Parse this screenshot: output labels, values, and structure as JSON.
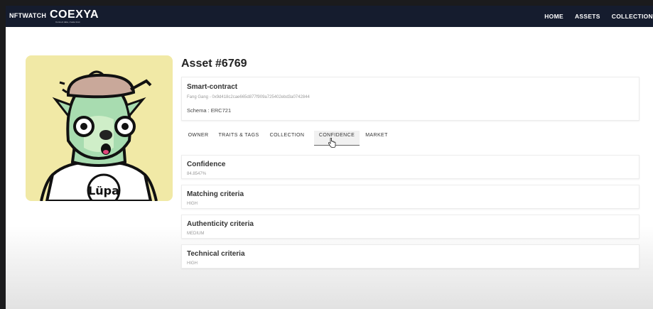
{
  "header": {
    "brand": "NFTWATCH",
    "logo_text": "COEXYA",
    "logo_tagline": "Connect data, create trust",
    "nav": [
      "HOME",
      "ASSETS",
      "COLLECTION"
    ]
  },
  "asset": {
    "title": "Asset #6769",
    "smart_contract": {
      "heading": "Smart-contract",
      "address": "Fang Gang - 0x9d418c2cae665d877f909a725402ebd3a0742844",
      "schema": "Schema : ERC721"
    },
    "tabs": [
      "OWNER",
      "TRAITS & TAGS",
      "COLLECTION",
      "CONFIDENCE",
      "MARKET"
    ],
    "active_tab": "CONFIDENCE",
    "criteria": [
      {
        "label": "Confidence",
        "value": "84.8547%"
      },
      {
        "label": "Matching criteria",
        "value": "HIGH"
      },
      {
        "label": "Authenticity criteria",
        "value": "MEDIUM"
      },
      {
        "label": "Technical criteria",
        "value": "HIGH"
      }
    ],
    "image_shirt_text": "Lüpa"
  },
  "colors": {
    "navbar_bg": "#151c2e",
    "image_bg": "#f1e9a6",
    "character_green": "#a8dcb0",
    "beret": "#c9a89a"
  }
}
